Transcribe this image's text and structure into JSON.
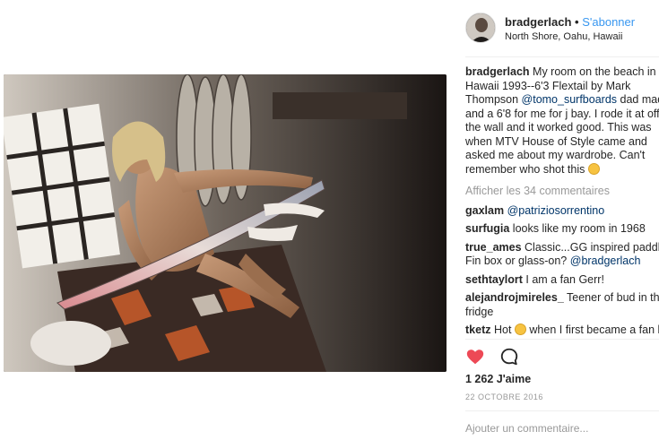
{
  "post": {
    "username": "bradgerlach",
    "separator": "•",
    "follow_label": "S'abonner",
    "location": "North Shore, Oahu, Hawaii",
    "caption_user": "bradgerlach",
    "caption_parts": {
      "p1": "My room on the beach in Hawaii 1993--6'3 Flextail by Mark Thompson ",
      "mention": "@tomo_surfboards",
      "p2": " dad made and a 6'8 for me for j bay. I rode it at off the wall and it worked good. This was when MTV House of Style came and asked me about my wardrobe. Can't remember who shot this"
    },
    "view_comments": "Afficher les 34 commentaires",
    "likes": "1 262 J'aime",
    "date": "22 OCTOBRE 2016",
    "add_comment_placeholder": "Ajouter un commentaire..."
  },
  "comments": [
    {
      "user": "gaxlam",
      "mention": "@patriziosorrentino",
      "text": ""
    },
    {
      "user": "surfugia",
      "text": "looks like my room in 1968"
    },
    {
      "user": "true_ames",
      "text": "Classic...GG inspired paddle Fin box or glass-on?",
      "mention_after": "@bradgerlach"
    },
    {
      "user": "sethtaylort",
      "text": "I am a fan Gerr!"
    },
    {
      "user": "alejandrojmireles_",
      "text": "Teener of bud in the fridge"
    },
    {
      "user": "tketz",
      "text": "Hot",
      "text2": "when I first became a fan l"
    }
  ],
  "colors": {
    "accent": "#3897f0",
    "like_red": "#ed4956",
    "muted": "#999999",
    "text": "#262626"
  },
  "icons": {
    "like": "heart-icon",
    "comment": "comment-bubble-icon"
  }
}
